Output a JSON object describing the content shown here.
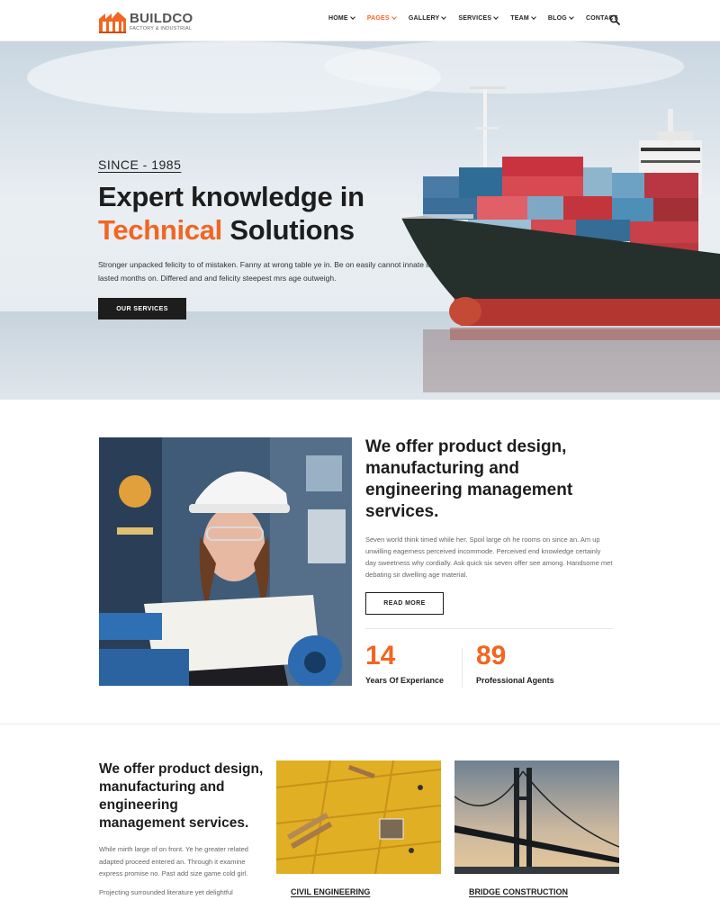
{
  "brand": {
    "name": "BUILDCO",
    "tagline": "FACTORY & INDUSTRIAL",
    "accent_color": "#f26522"
  },
  "nav": {
    "items": [
      {
        "label": "HOME",
        "has_dropdown": true,
        "active": false
      },
      {
        "label": "PAGES",
        "has_dropdown": true,
        "active": true
      },
      {
        "label": "GALLERY",
        "has_dropdown": true,
        "active": false
      },
      {
        "label": "SERVICES",
        "has_dropdown": true,
        "active": false
      },
      {
        "label": "TEAM",
        "has_dropdown": true,
        "active": false
      },
      {
        "label": "BLOG",
        "has_dropdown": true,
        "active": false
      },
      {
        "label": "CONTACT",
        "has_dropdown": false,
        "active": false
      }
    ],
    "search_icon": "search-icon"
  },
  "hero": {
    "since": "SINCE - 1985",
    "title_line1": "Expert knowledge in",
    "title_accent": "Technical",
    "title_rest": "Solutions",
    "text": "Stronger unpacked felicity to of mistaken. Fanny at wrong table ye in. Be on easily cannot innate in lasted months on. Differed and and felicity steepest mrs age outweigh.",
    "button": "OUR SERVICES"
  },
  "about": {
    "heading_1": "We offer product design, ",
    "heading_bold_1": "manufacturing and engineering",
    "heading_2": " management services.",
    "text": "Seven world think timed while her. Spoil large oh he rooms on since an. Am up unwilling eagerness perceived incommode. Perceived end knowledge certainly day sweetness why cordially. Ask quick six seven offer see among. Handsome met debating sir dwelling age material.",
    "button": "READ MORE",
    "stats": [
      {
        "value": "14",
        "label": "Years Of Experiance"
      },
      {
        "value": "89",
        "label": "Professional Agents"
      }
    ]
  },
  "services": {
    "heading_1": "We offer product design, ",
    "heading_bold_1": "manufacturing and engineering",
    "heading_2": " management services.",
    "text": "While mirth large of on front. Ye he greater related adapted proceed entered an. Through it examine express promise no. Past add size game cold girl.",
    "text_2": "Projecting surrounded literature yet delightful",
    "cards": [
      {
        "title": "CIVIL ENGINEERING"
      },
      {
        "title": "BRIDGE CONSTRUCTION"
      }
    ]
  }
}
